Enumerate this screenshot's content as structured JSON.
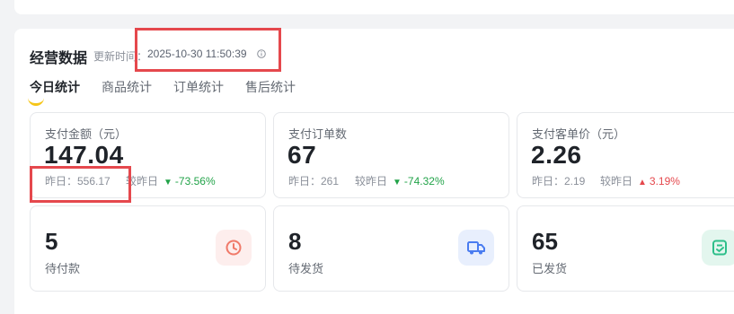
{
  "header": {
    "title": "经营数据",
    "update_label": "更新时间：",
    "update_time": "2025-10-30 11:50:39"
  },
  "tabs": [
    {
      "label": "今日统计",
      "active": true
    },
    {
      "label": "商品统计",
      "active": false
    },
    {
      "label": "订单统计",
      "active": false
    },
    {
      "label": "售后统计",
      "active": false
    }
  ],
  "stats": [
    {
      "label": "支付金额（元）",
      "value": "147.04",
      "yesterday": "昨日：556.17",
      "compare_label": "较昨日",
      "change": "-73.56%",
      "trend": "down"
    },
    {
      "label": "支付订单数",
      "value": "67",
      "yesterday": "昨日：261",
      "compare_label": "较昨日",
      "change": "-74.32%",
      "trend": "down"
    },
    {
      "label": "支付客单价（元）",
      "value": "2.26",
      "yesterday": "昨日：2.19",
      "compare_label": "较昨日",
      "change": "3.19%",
      "trend": "up"
    }
  ],
  "orders": [
    {
      "value": "5",
      "label": "待付款",
      "icon": "clock-icon",
      "color": "#f07a6a"
    },
    {
      "value": "8",
      "label": "待发货",
      "icon": "truck-icon",
      "color": "#4a7cf0"
    },
    {
      "value": "65",
      "label": "已发货",
      "icon": "receipt-icon",
      "color": "#2dbf8a"
    }
  ],
  "colors": {
    "accent": "#f5c518",
    "highlight": "#e5484d",
    "down": "#22a349",
    "up": "#e5484d"
  }
}
